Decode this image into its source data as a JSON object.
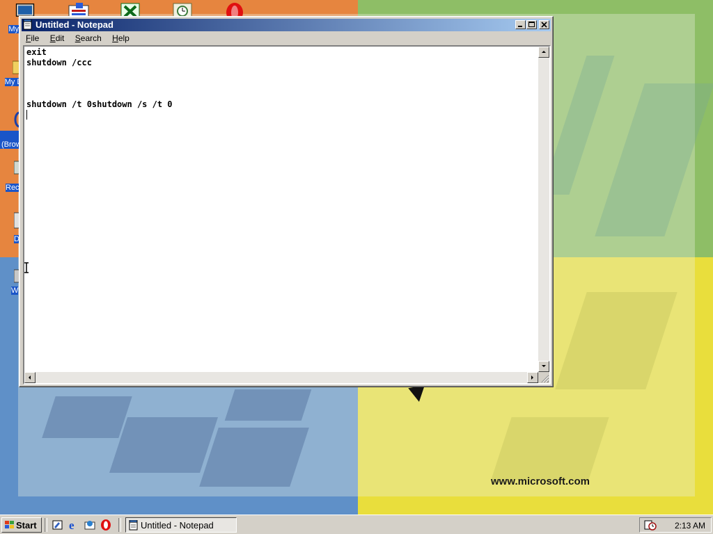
{
  "desktop": {
    "icons": [
      {
        "label": "My C",
        "icon": "my-computer-icon"
      },
      {
        "label": "My Dr",
        "icon": "my-documents-icon"
      },
      {
        "label": "(Brow",
        "icon": "internet-explorer-icon"
      },
      {
        "label": "Rec",
        "icon": "recycle-bin-icon"
      },
      {
        "label": "D",
        "icon": "document-icon"
      },
      {
        "label": "W",
        "icon": "winzip-icon"
      }
    ],
    "top_icons": [
      "outlook-icon",
      "excel-icon",
      "scheduler-icon",
      "opera-icon"
    ],
    "wallpaper_text": "www.microsoft.com"
  },
  "notepad": {
    "title": "Untitled - Notepad",
    "menu": [
      {
        "label": "File",
        "accel": "F",
        "rest": "ile"
      },
      {
        "label": "Edit",
        "accel": "E",
        "rest": "dit"
      },
      {
        "label": "Search",
        "accel": "S",
        "rest": "earch"
      },
      {
        "label": "Help",
        "accel": "H",
        "rest": "elp"
      }
    ],
    "content": "exit\nshutdown /ccc\n\n\n\nshutdown /t 0shutdown /s /t 0\n"
  },
  "taskbar": {
    "start_label": "Start",
    "quick_launch": [
      "show-desktop-icon",
      "internet-explorer-icon",
      "outlook-express-icon",
      "opera-icon"
    ],
    "task_label": "Untitled - Notepad",
    "clock": "2:13 AM"
  },
  "colors": {
    "titlebar_start": "#0a246a",
    "titlebar_end": "#a6caf0",
    "face": "#d4d0c8"
  }
}
